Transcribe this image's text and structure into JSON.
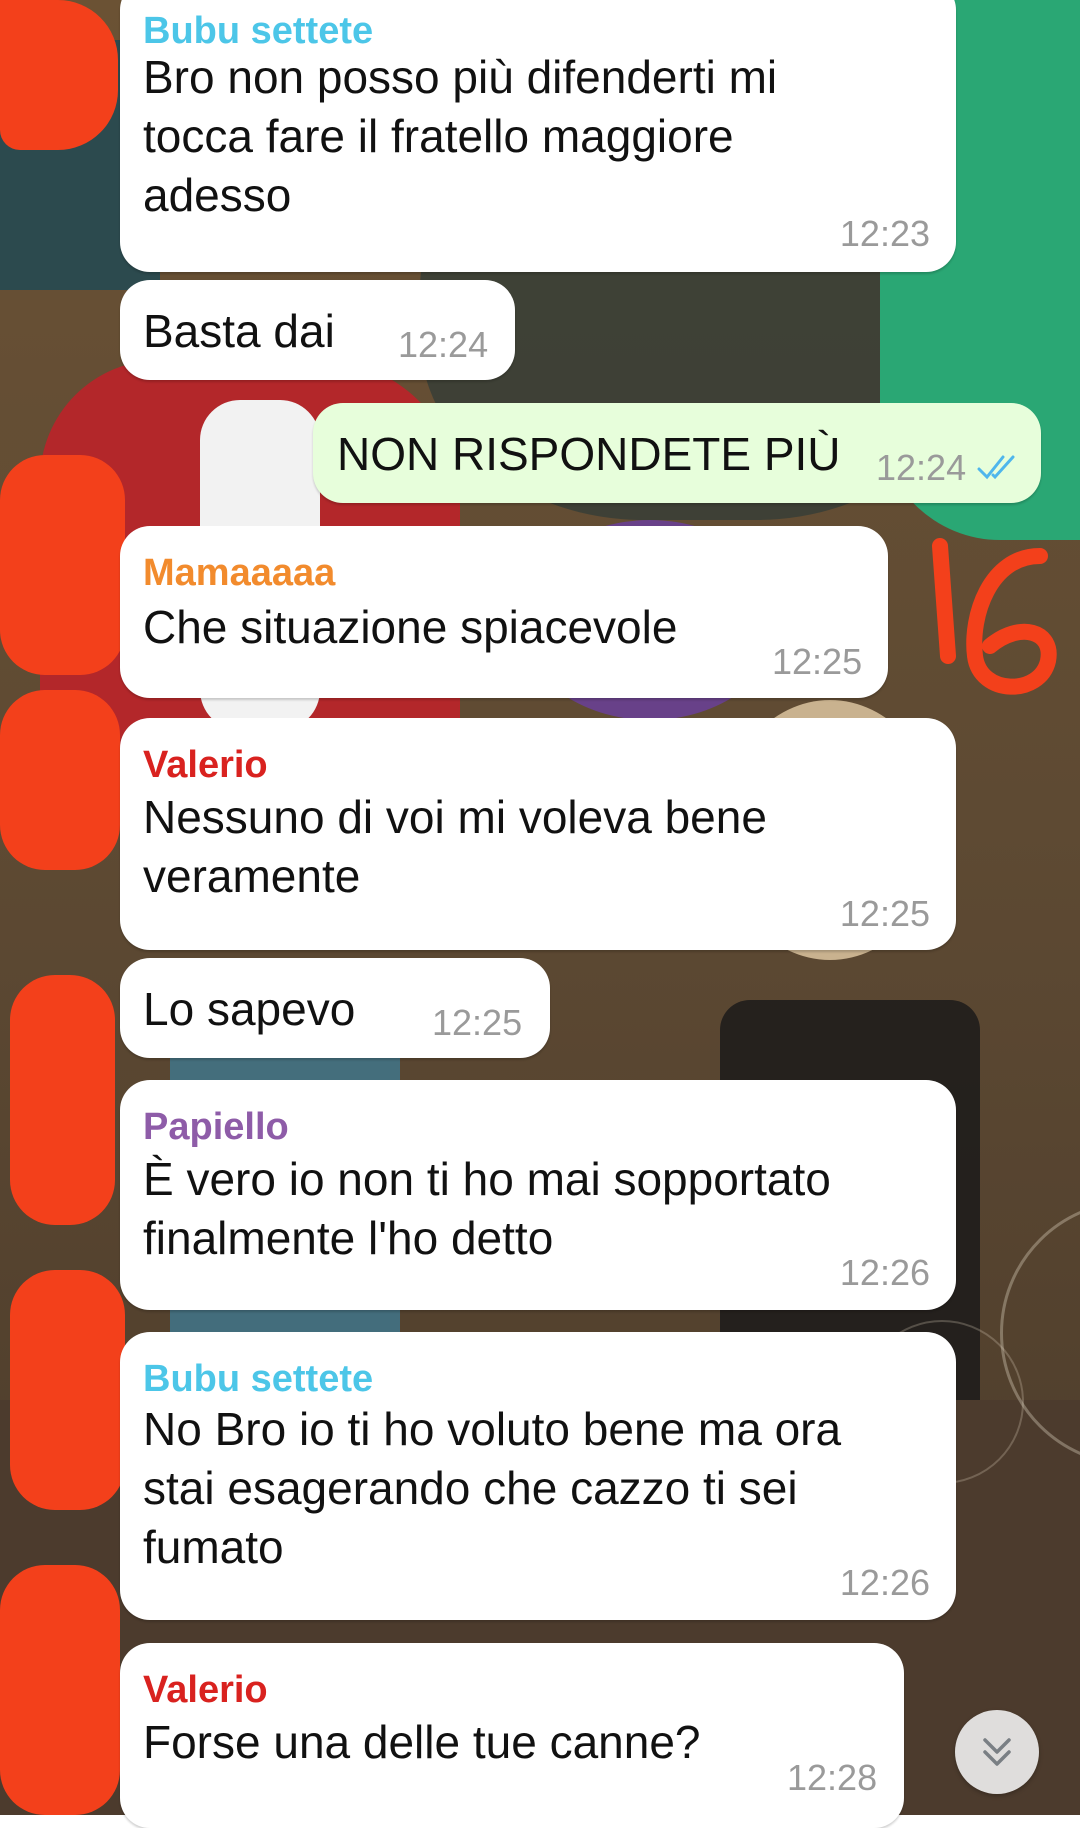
{
  "colors": {
    "incoming_bubble": "#ffffff",
    "outgoing_bubble": "#e7fedb",
    "timestamp": "#9a9a9a",
    "read_ticks": "#4fb6ec",
    "sender_bubu": "#4cc6e8",
    "sender_mama": "#f28b2d",
    "sender_valerio": "#d9221f",
    "sender_papiello": "#8e5ca8",
    "redaction_marker": "#f3401b"
  },
  "messages": [
    {
      "sender": "Bubu settete",
      "text": "Bro non posso più difenderti mi tocca fare il fratello maggiore adesso",
      "time": "12:23"
    },
    {
      "sender": "",
      "text": "Basta dai",
      "time": "12:24"
    },
    {
      "sender": "",
      "text": "NON RISPONDETE PIÙ",
      "time": "12:24",
      "outgoing": true,
      "status_icon": "double-check-icon"
    },
    {
      "sender": "Mamaaaaa",
      "text": "Che situazione spiacevole",
      "time": "12:25"
    },
    {
      "sender": "Valerio",
      "text": "Nessuno di voi mi voleva bene veramente",
      "time": "12:25"
    },
    {
      "sender": "",
      "text": "Lo sapevo",
      "time": "12:25"
    },
    {
      "sender": "Papiello",
      "text": "È vero io non ti ho mai sopportato finalmente l'ho detto",
      "time": "12:26"
    },
    {
      "sender": "Bubu settete",
      "text": "No Bro io ti ho voluto bene ma ora stai esagerando che cazzo ti sei fumato",
      "time": "12:26"
    },
    {
      "sender": "Valerio",
      "text": "Forse una delle tue canne?",
      "time": "12:28"
    }
  ],
  "annotation": {
    "handwritten_number": "16"
  },
  "scroll_button": {
    "icon": "chevron-double-down-icon"
  }
}
